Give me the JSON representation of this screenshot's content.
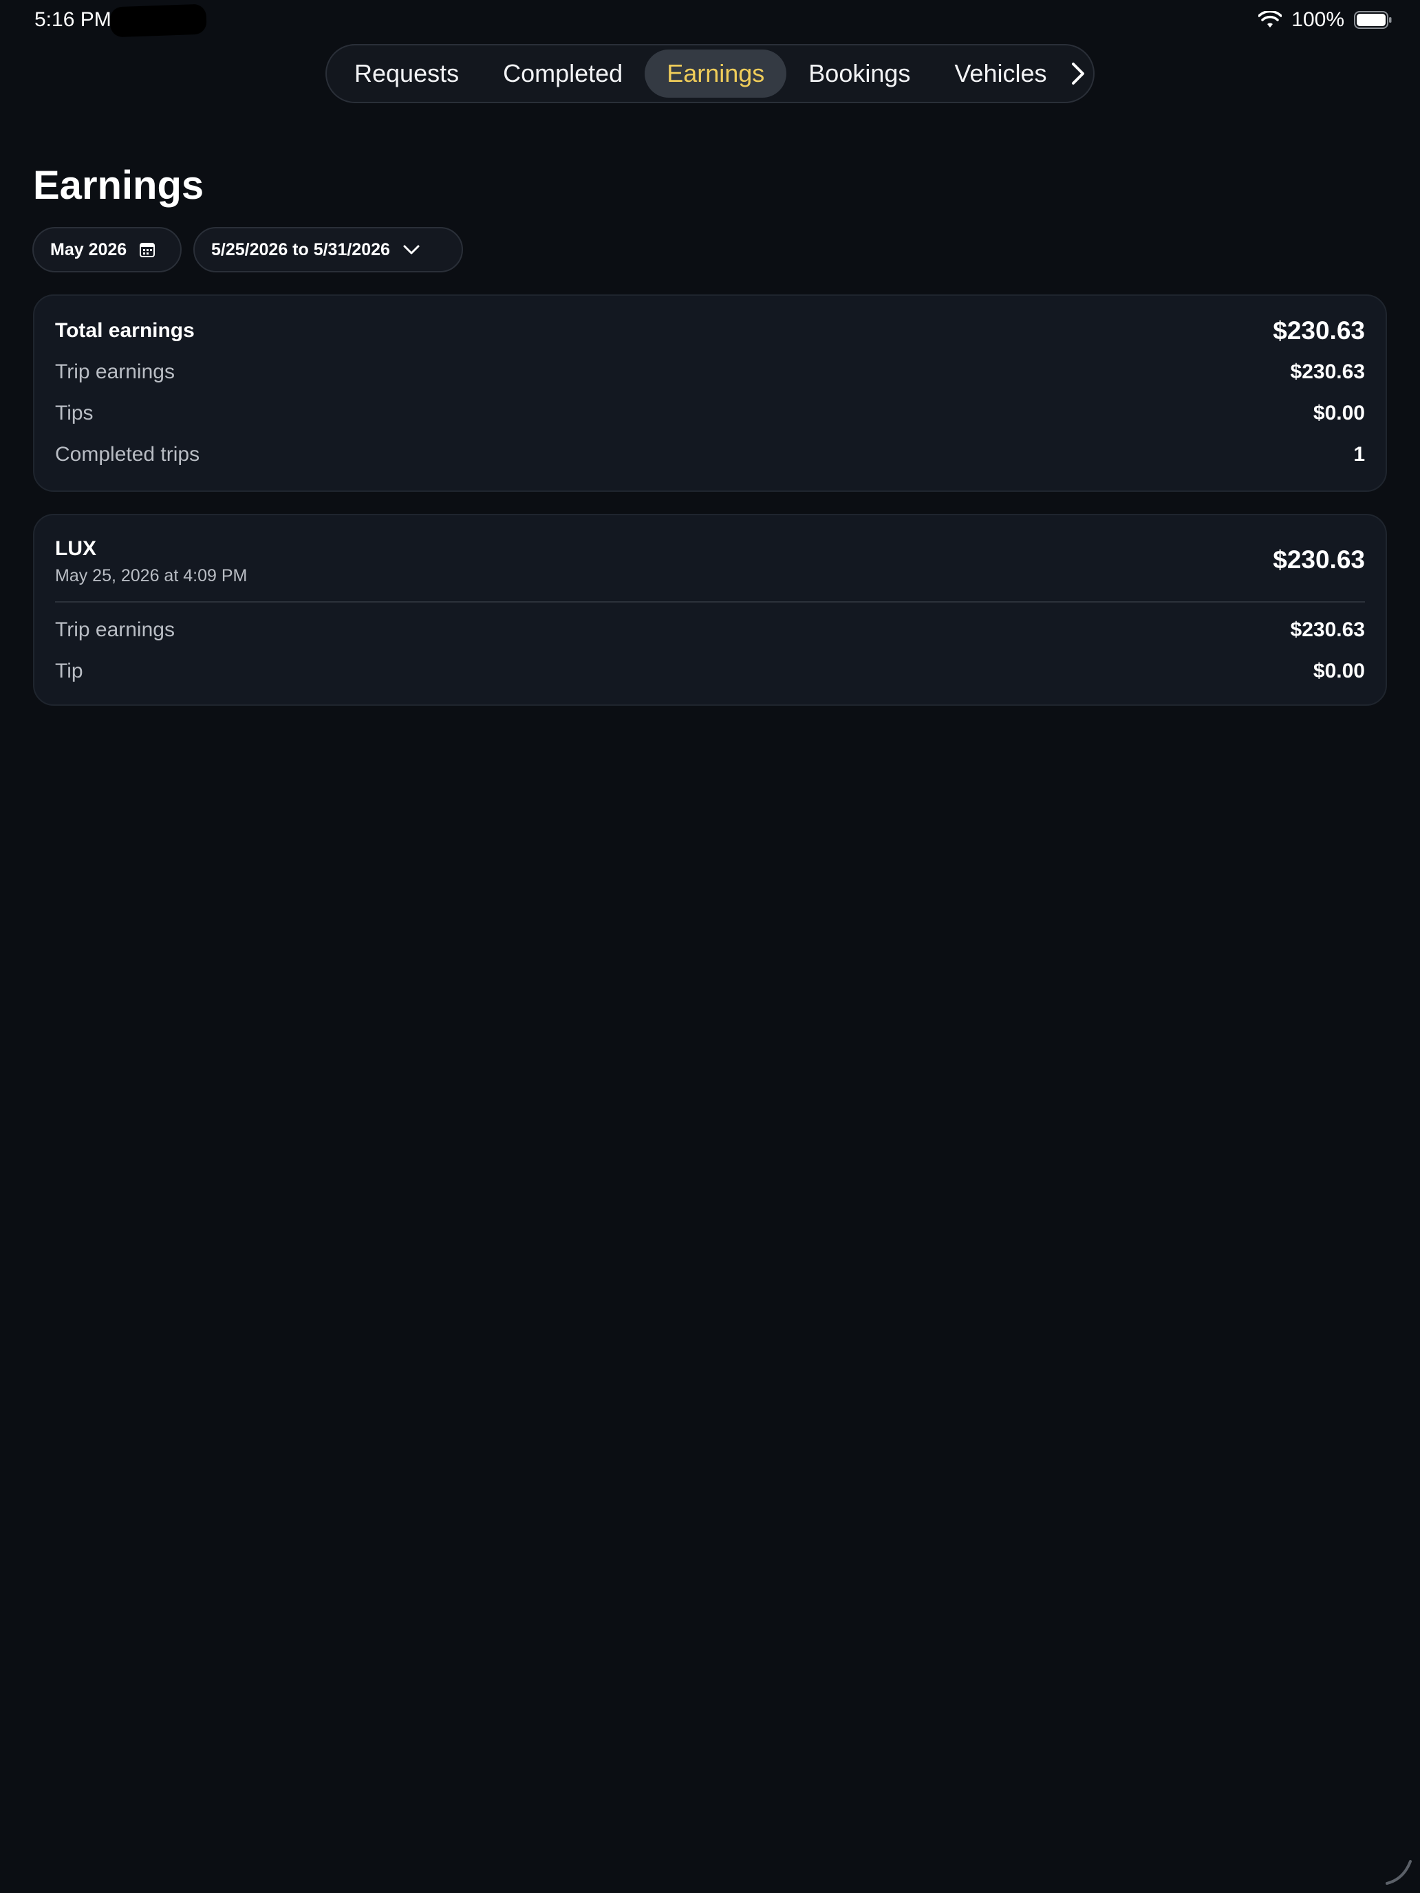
{
  "status": {
    "time": "5:16 PM",
    "battery": "100%"
  },
  "tabs": [
    {
      "label": "Requests",
      "active": false
    },
    {
      "label": "Completed",
      "active": false
    },
    {
      "label": "Earnings",
      "active": true
    },
    {
      "label": "Bookings",
      "active": false
    },
    {
      "label": "Vehicles",
      "active": false
    }
  ],
  "page": {
    "title": "Earnings"
  },
  "filters": {
    "month": "May 2026",
    "range": "5/25/2026 to 5/31/2026"
  },
  "summary": {
    "total_label": "Total earnings",
    "total_value": "$230.63",
    "trip_label": "Trip earnings",
    "trip_value": "$230.63",
    "tips_label": "Tips",
    "tips_value": "$0.00",
    "completed_label": "Completed trips",
    "completed_value": "1"
  },
  "trip": {
    "name": "LUX",
    "date": "May 25, 2026 at 4:09 PM",
    "total": "$230.63",
    "earnings_label": "Trip earnings",
    "earnings_value": "$230.63",
    "tip_label": "Tip",
    "tip_value": "$0.00"
  },
  "colors": {
    "background": "#0b0e13",
    "card": "#131821",
    "accent": "#f0cd5a",
    "active_tab": "#343a43"
  },
  "icons": [
    "wifi-icon",
    "battery-icon",
    "chevron-right-icon",
    "calendar-icon",
    "chevron-down-icon"
  ]
}
